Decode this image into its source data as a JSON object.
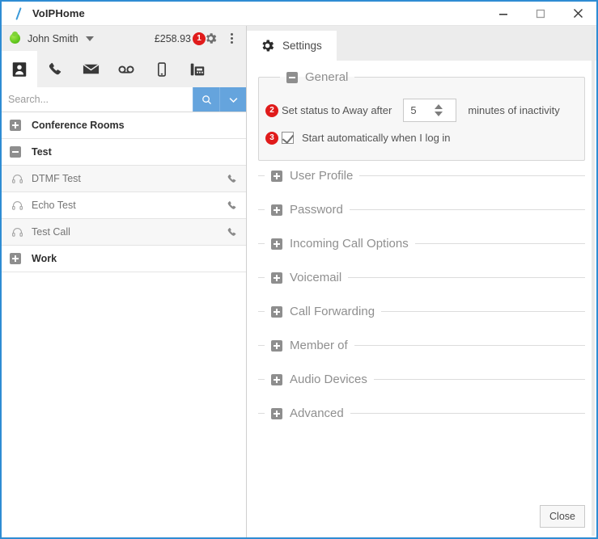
{
  "titlebar": {
    "app_title": "VoIPHome",
    "logo_icon": "backslash-logo-icon",
    "minimize_label": "minimize-icon",
    "maximize_label": "maximize-icon",
    "close_label": "close-icon"
  },
  "account": {
    "presence": "available",
    "presence_color": "#62c81e",
    "name": "John Smith",
    "balance": "£258.93",
    "badge": "1",
    "gear_icon": "gear-icon",
    "menu_icon": "kebab-menu-icon"
  },
  "icon_tabs": [
    {
      "name": "contacts",
      "icon": "contact-card-icon",
      "active": true
    },
    {
      "name": "calls",
      "icon": "phone-icon",
      "active": false
    },
    {
      "name": "messages",
      "icon": "envelope-icon",
      "active": false
    },
    {
      "name": "voicemail",
      "icon": "voicemail-icon",
      "active": false
    },
    {
      "name": "mobile",
      "icon": "mobile-phone-icon",
      "active": false
    },
    {
      "name": "fax",
      "icon": "fax-machine-icon",
      "active": false
    }
  ],
  "search": {
    "placeholder": "Search...",
    "value": "",
    "search_icon": "magnifier-icon",
    "dropdown_icon": "chevron-down-icon",
    "button_color": "#65a4dd"
  },
  "contacts": [
    {
      "type": "group",
      "label": "Conference Rooms",
      "expanded": false,
      "toggle_icon": "plus-box-icon"
    },
    {
      "type": "group",
      "label": "Test",
      "expanded": true,
      "toggle_icon": "minus-box-icon"
    },
    {
      "type": "contact",
      "label": "DTMF Test",
      "icon": "headset-icon",
      "action_icon": "phone-icon"
    },
    {
      "type": "contact",
      "label": "Echo Test",
      "icon": "headset-icon",
      "action_icon": "phone-icon"
    },
    {
      "type": "contact",
      "label": "Test Call",
      "icon": "headset-icon",
      "action_icon": "phone-icon"
    },
    {
      "type": "group",
      "label": "Work",
      "expanded": false,
      "toggle_icon": "plus-box-icon"
    }
  ],
  "settings": {
    "tab_label": "Settings",
    "tab_icon": "gear-icon",
    "general": {
      "legend": "General",
      "toggle_icon": "minus-box-icon",
      "away_marker": "2",
      "away_label": "Set status to Away after",
      "away_value": "5",
      "away_suffix": "minutes of inactivity",
      "autostart_marker": "3",
      "autostart_label": "Start automatically when I log in",
      "autostart_checked": true
    },
    "sections": [
      {
        "label": "User Profile",
        "toggle_icon": "plus-box-icon"
      },
      {
        "label": "Password",
        "toggle_icon": "plus-box-icon"
      },
      {
        "label": "Incoming Call Options",
        "toggle_icon": "plus-box-icon"
      },
      {
        "label": "Voicemail",
        "toggle_icon": "plus-box-icon"
      },
      {
        "label": "Call Forwarding",
        "toggle_icon": "plus-box-icon"
      },
      {
        "label": "Member of",
        "toggle_icon": "plus-box-icon"
      },
      {
        "label": "Audio Devices",
        "toggle_icon": "plus-box-icon"
      },
      {
        "label": "Advanced",
        "toggle_icon": "plus-box-icon"
      }
    ],
    "close_label": "Close"
  },
  "colors": {
    "window_border": "#2e8cd3",
    "badge_red": "#e01b1b",
    "accent_blue": "#65a4dd"
  }
}
